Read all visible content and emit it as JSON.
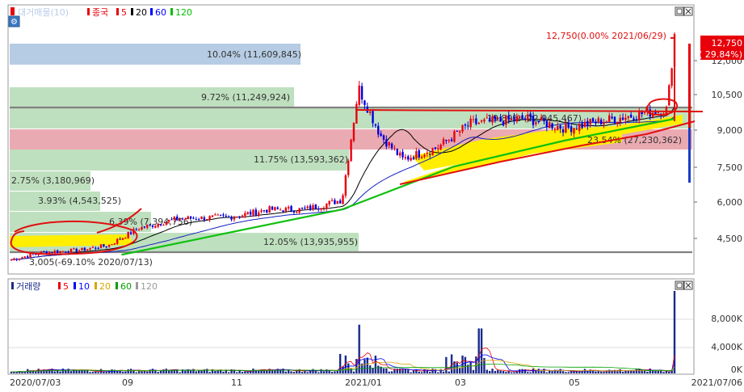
{
  "price_panel": {
    "legend": [
      {
        "label": "대거매물(10)",
        "color": "#b9cde6"
      },
      {
        "label": "종국",
        "color": "#e8000b"
      },
      {
        "label": "5",
        "color": "#e8000b"
      },
      {
        "label": "20",
        "color": "#000000"
      },
      {
        "label": "60",
        "color": "#0000ff"
      },
      {
        "label": "120",
        "color": "#00c000"
      }
    ],
    "y_ticks": [
      "12,000",
      "10,500",
      "9,000",
      "7,500",
      "6,000",
      "4,500"
    ],
    "current_price": "12,750",
    "current_change": "( 29.84%)",
    "annotation": "12,750(0.00% 2021/06/29)",
    "low_annotation": "3,005(-69.10% 2020/07/13)",
    "volume_profile_labels": [
      "10.04% (11,609,845)",
      "9.72% (11,249,924)",
      "11.75% (13,593,362)",
      "2.75% (3,180,969)",
      "3.93% (4,543,525)",
      "6.39% (7,394,756)",
      "12.05% (13,935,955)",
      "19.89% (22,945,467)",
      "23.54% (27,230,362)"
    ]
  },
  "volume_panel": {
    "legend": [
      {
        "label": "거래량",
        "color": "#1a2a8a"
      },
      {
        "label": "5",
        "color": "#e8000b"
      },
      {
        "label": "10",
        "color": "#0000ff"
      },
      {
        "label": "20",
        "color": "#d9a400"
      },
      {
        "label": "60",
        "color": "#00a000"
      },
      {
        "label": "120",
        "color": "#9a9a9a"
      }
    ],
    "y_ticks": [
      "8,000K",
      "4,000K",
      "0K"
    ]
  },
  "x_axis": {
    "labels": [
      "2020/07/03",
      "09",
      "11",
      "2021/01",
      "03",
      "05",
      "2021/07/06"
    ]
  },
  "chart_data": {
    "type": "candlestick",
    "y_range": [
      3000,
      13500
    ],
    "volume_range_k": [
      0,
      11000
    ],
    "x_range": [
      "2020/07/03",
      "2021/07/06"
    ],
    "last_close": 12750,
    "close_path": [
      [
        "2020/07/03",
        3300
      ],
      [
        "2020/07/20",
        3600
      ],
      [
        "2020/08/10",
        3700
      ],
      [
        "2020/08/25",
        3900
      ],
      [
        "2020/09/10",
        4600
      ],
      [
        "2020/10/01",
        5000
      ],
      [
        "2020/11/01",
        5100
      ],
      [
        "2020/11/20",
        5400
      ],
      [
        "2020/12/10",
        5400
      ],
      [
        "2020/12/30",
        5800
      ],
      [
        "2021/01/08",
        10500
      ],
      [
        "2021/01/20",
        8500
      ],
      [
        "2021/02/01",
        7500
      ],
      [
        "2021/02/20",
        8000
      ],
      [
        "2021/03/10",
        9000
      ],
      [
        "2021/04/10",
        9200
      ],
      [
        "2021/05/01",
        8800
      ],
      [
        "2021/05/20",
        9100
      ],
      [
        "2021/06/10",
        9400
      ],
      [
        "2021/06/25",
        9600
      ],
      [
        "2021/06/29",
        12750
      ]
    ],
    "ma120_path": [
      [
        "2020/09/01",
        3500
      ],
      [
        "2020/12/30",
        5400
      ],
      [
        "2021/03/01",
        7200
      ],
      [
        "2021/05/01",
        8300
      ],
      [
        "2021/06/29",
        9200
      ]
    ],
    "volume_spikes_k": [
      [
        "2021/01/08",
        6500
      ],
      [
        "2021/03/15",
        6000
      ],
      [
        "2021/06/29",
        11000
      ]
    ]
  },
  "colors": {
    "profile_blue": "#b6cce4",
    "profile_green": "#bfe0bf",
    "profile_red": "#eaaab1",
    "candle_up": "#e8000b",
    "candle_down": "#0000dd",
    "ma5": "#e8000b",
    "ma20": "#000000",
    "ma60": "#1020c0",
    "ma120": "#10c010",
    "highlight": "#ffee00"
  }
}
